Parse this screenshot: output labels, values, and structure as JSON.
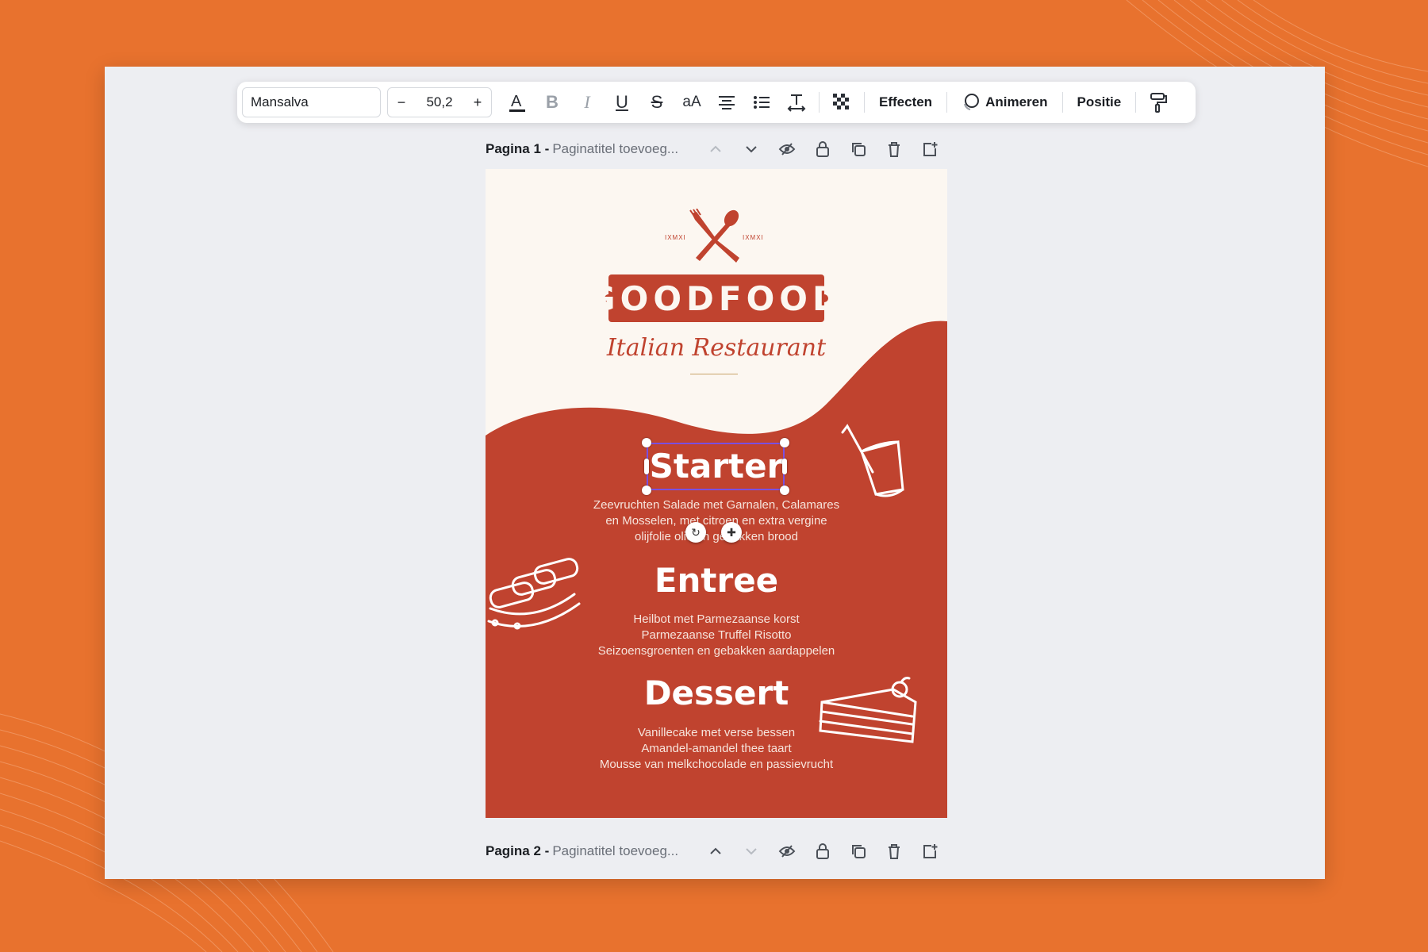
{
  "toolbar": {
    "font": "Mansalva",
    "font_size": "50,2",
    "minus": "−",
    "plus": "+",
    "case_toggle": "aA",
    "effects": "Effecten",
    "animate": "Animeren",
    "position": "Positie"
  },
  "pages": [
    {
      "label": "Pagina 1 -",
      "title_placeholder": "Paginatitel toevoeg..."
    },
    {
      "label": "Pagina 2 -",
      "title_placeholder": "Paginatitel toevoeg..."
    }
  ],
  "design": {
    "logo": "GOODFOOD",
    "tag_left": "IXMXI",
    "tag_right": "IXMXI",
    "subtitle": "Italian Restaurant",
    "sections": [
      {
        "title": "Starter",
        "lines": [
          "Zeevruchten Salade met Garnalen, Calamares",
          "en Mosselen, met citroen en extra vergine",
          "olijfolie olie en gebakken brood"
        ]
      },
      {
        "title": "Entree",
        "lines": [
          "Heilbot met Parmezaanse korst",
          "Parmezaanse Truffel Risotto",
          "Seizoensgroenten en gebakken aardappelen"
        ]
      },
      {
        "title": "Dessert",
        "lines": [
          "Vanillecake met verse bessen",
          "Amandel-amandel thee taart",
          "Mousse van melkchocolade en passievrucht"
        ]
      }
    ]
  },
  "colors": {
    "background": "#E8722E",
    "brand_red": "#C0432F",
    "cream": "#FCF7F1",
    "selection": "#7B4FE0"
  }
}
